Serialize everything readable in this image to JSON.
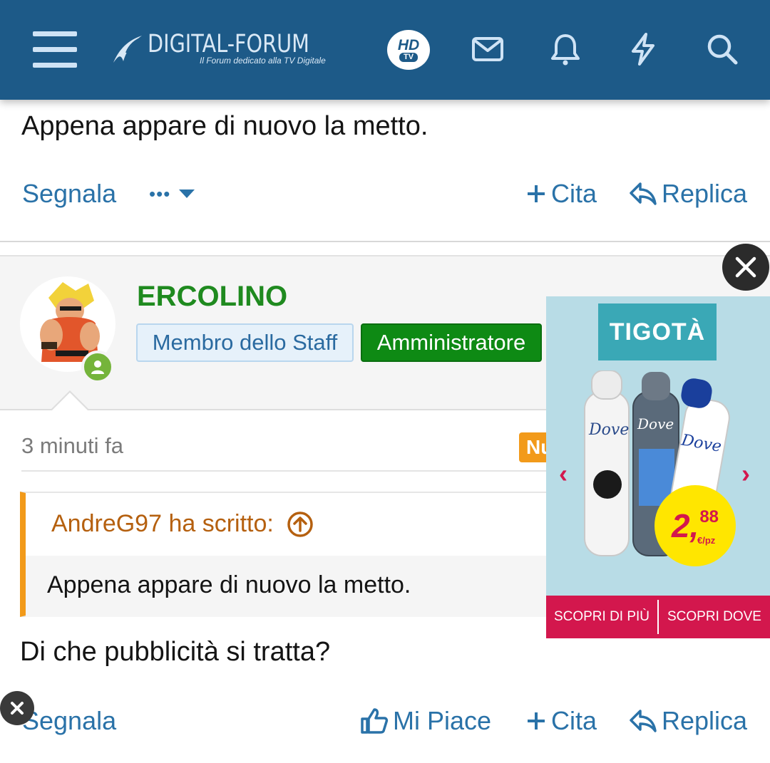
{
  "header": {
    "logo_title": "DIGITAL-FORUM",
    "logo_subtitle": "Il Forum dedicato alla TV Digitale",
    "hd_badge": "HD",
    "hd_badge_tv": "TV",
    "icons": [
      "menu-icon",
      "mail-icon",
      "bell-icon",
      "bolt-icon",
      "search-icon"
    ]
  },
  "post1": {
    "text": "Appena appare di nuovo la metto.",
    "actions": {
      "report": "Segnala",
      "more": "•••",
      "quote": "Cita",
      "reply": "Replica"
    }
  },
  "post2": {
    "username": "ERCOLINO",
    "badges": [
      "Membro dello Staff",
      "Amministratore"
    ],
    "time": "3 minuti fa",
    "new_badge": "Nuovo",
    "quote": {
      "author": "AndreG97 ha scritto:",
      "text": "Appena appare di nuovo la metto."
    },
    "text": "Di che pubblicità si tratta?",
    "actions": {
      "report": "Segnala",
      "like": "Mi Piace",
      "quote": "Cita",
      "reply": "Replica"
    }
  },
  "ad": {
    "brand": "TIGOTÀ",
    "product": "Dove",
    "price_int": "2,",
    "price_dec": "88",
    "price_unit": "€/pz",
    "cta_more": "SCOPRI DI PIÙ",
    "cta_where": "SCOPRI DOVE"
  },
  "colors": {
    "header_bg": "#1d5a88",
    "link": "#2a72a8",
    "username": "#1f8a1f",
    "admin_badge": "#0e8a14",
    "quote_accent": "#f29a1a",
    "ad_pink": "#d3174d"
  }
}
